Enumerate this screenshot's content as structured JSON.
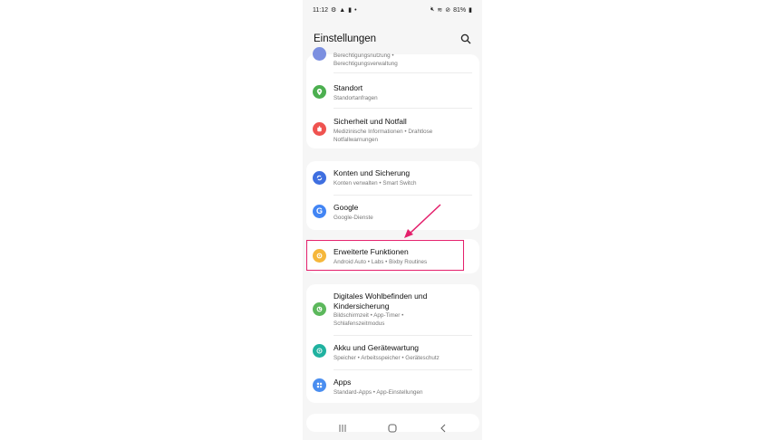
{
  "status": {
    "time": "11:12",
    "battery": "81%"
  },
  "header": {
    "title": "Einstellungen"
  },
  "top_partial": {
    "sub1": "Berechtigungsnutzung •",
    "sub2": "Berechtigungsverwaltung"
  },
  "items": [
    {
      "title": "Standort",
      "sub": "Standortanfragen",
      "color": "#4caf50",
      "icon": "location-icon"
    },
    {
      "title": "Sicherheit und Notfall",
      "sub": "Medizinische Informationen • Drahtlose Notfallwarnungen",
      "color": "#ef5350",
      "icon": "emergency-icon"
    },
    {
      "title": "Konten und Sicherung",
      "sub": "Konten verwalten • Smart Switch",
      "color": "#3f6fe0",
      "icon": "sync-icon"
    },
    {
      "title": "Google",
      "sub": "Google-Dienste",
      "color": "#4285f4",
      "icon": "google-icon"
    },
    {
      "title": "Erweiterte Funktionen",
      "sub": "Android Auto • Labs • Bixby Routines",
      "color": "#f5b73b",
      "icon": "gear-plus-icon"
    },
    {
      "title": "Digitales Wohlbefinden und Kindersicherung",
      "title_line1": "Digitales Wohlbefinden und",
      "title_line2": "Kindersicherung",
      "sub": "Bildschirmzeit • App-Timer • Schlafenszeitmodus",
      "color": "#5cb85c",
      "icon": "wellbeing-icon"
    },
    {
      "title": "Akku und Gerätewartung",
      "sub": "Speicher • Arbeitsspeicher • Geräteschutz",
      "color": "#20b2a0",
      "icon": "battery-care-icon"
    },
    {
      "title": "Apps",
      "sub": "Standard-Apps • App-Einstellungen",
      "color": "#4a8ef0",
      "icon": "apps-grid-icon"
    }
  ],
  "annotation": {
    "color": "#e4206c"
  }
}
